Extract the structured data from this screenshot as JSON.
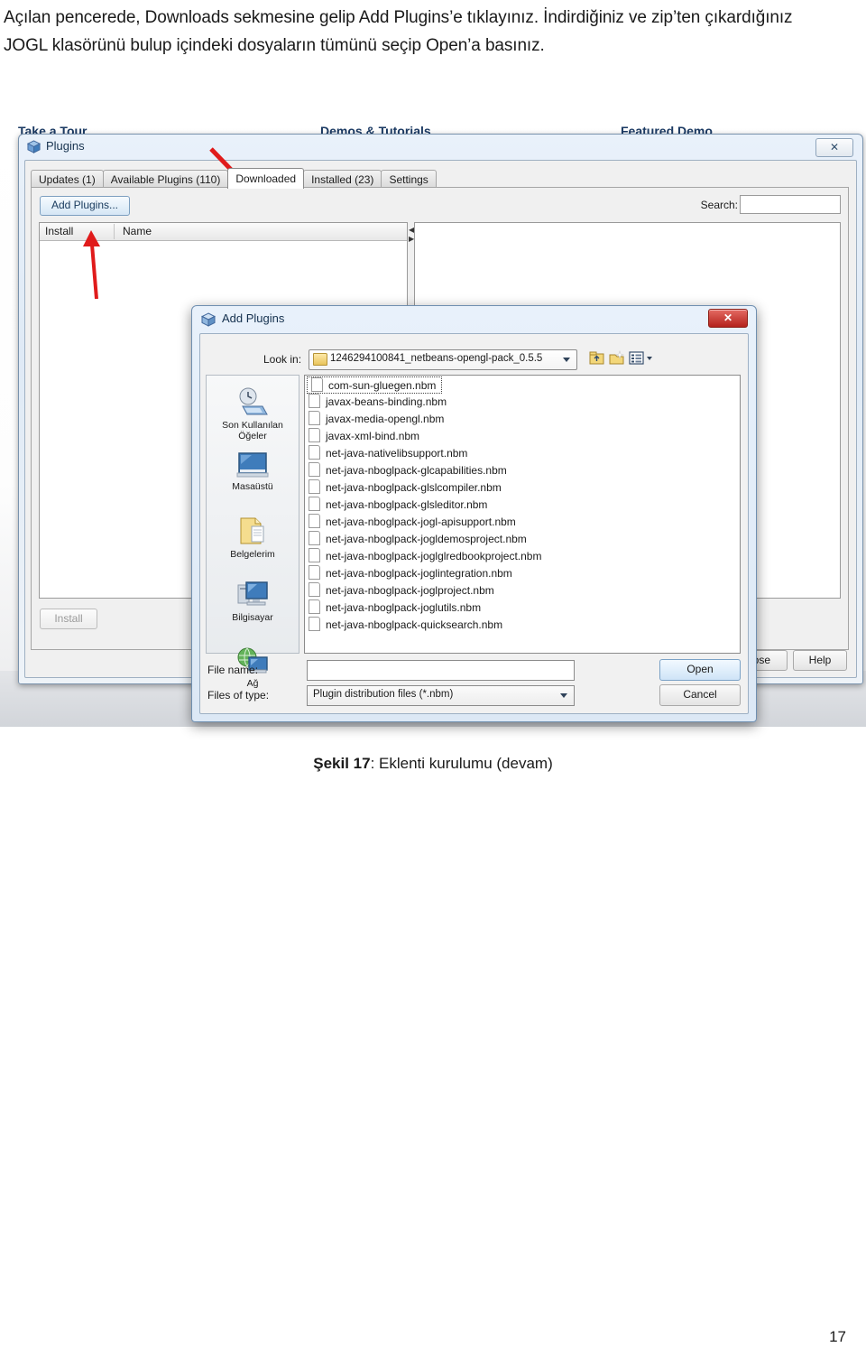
{
  "document": {
    "body_text": "Açılan pencerede, Downloads sekmesine gelip Add Plugins’e tıklayınız. İndirdiğiniz ve zip’ten çıkardığınız JOGL klasörünü bulup içindeki dosyaların tümünü seçip Open’a basınız.",
    "caption_label": "Şekil 17",
    "caption_text": ": Eklenti kurulumu (devam)",
    "page_number": "17"
  },
  "startpage": {
    "headings": [
      "Take a Tour",
      "Demos & Tutorials",
      "Featured Demo"
    ]
  },
  "plugins_window": {
    "title": "Plugins",
    "icon": "cube-icon",
    "close_label": "✕",
    "tabs": [
      {
        "label": "Updates (1)",
        "active": false
      },
      {
        "label": "Available Plugins (110)",
        "active": false
      },
      {
        "label": "Downloaded",
        "active": true
      },
      {
        "label": "Installed (23)",
        "active": false
      },
      {
        "label": "Settings",
        "active": false
      }
    ],
    "add_plugins_label": "Add Plugins...",
    "table_headers": [
      "Install",
      "Name"
    ],
    "search_label": "Search:",
    "search_value": "",
    "search_placeholder": "",
    "install_label": "Install",
    "close_label_btn": "lose",
    "help_label": "Help"
  },
  "add_plugins_dialog": {
    "title": "Add Plugins",
    "icon": "cube-icon",
    "close_label": "✕",
    "lookin_label": "Look in:",
    "lookin_value": "1246294100841_netbeans-opengl-pack_0.5.5",
    "toolbar_icons": [
      "up-one-level-icon",
      "new-folder-icon",
      "view-menu-icon"
    ],
    "places": [
      {
        "label": "Son Kullanılan Öğeler",
        "icon": "recent-items-icon"
      },
      {
        "label": "Masaüstü",
        "icon": "desktop-icon"
      },
      {
        "label": "Belgelerim",
        "icon": "documents-icon"
      },
      {
        "label": "Bilgisayar",
        "icon": "computer-icon"
      },
      {
        "label": "Ağ",
        "icon": "network-icon"
      }
    ],
    "files": [
      "com-sun-gluegen.nbm",
      "javax-beans-binding.nbm",
      "javax-media-opengl.nbm",
      "javax-xml-bind.nbm",
      "net-java-nativelibsupport.nbm",
      "net-java-nboglpack-glcapabilities.nbm",
      "net-java-nboglpack-glslcompiler.nbm",
      "net-java-nboglpack-glsleditor.nbm",
      "net-java-nboglpack-jogl-apisupport.nbm",
      "net-java-nboglpack-jogldemosproject.nbm",
      "net-java-nboglpack-joglglredbookproject.nbm",
      "net-java-nboglpack-joglintegration.nbm",
      "net-java-nboglpack-joglproject.nbm",
      "net-java-nboglpack-joglutils.nbm",
      "net-java-nboglpack-quicksearch.nbm"
    ],
    "filename_label": "File name:",
    "filename_value": "",
    "filetype_label": "Files of type:",
    "filetype_value": "Plugin distribution files (*.nbm)",
    "open_label": "Open",
    "cancel_label": "Cancel"
  },
  "annotations": {
    "arrow_color": "#e01b1b",
    "arrow_targets": [
      "downloaded-tab",
      "add-plugins-button"
    ]
  }
}
